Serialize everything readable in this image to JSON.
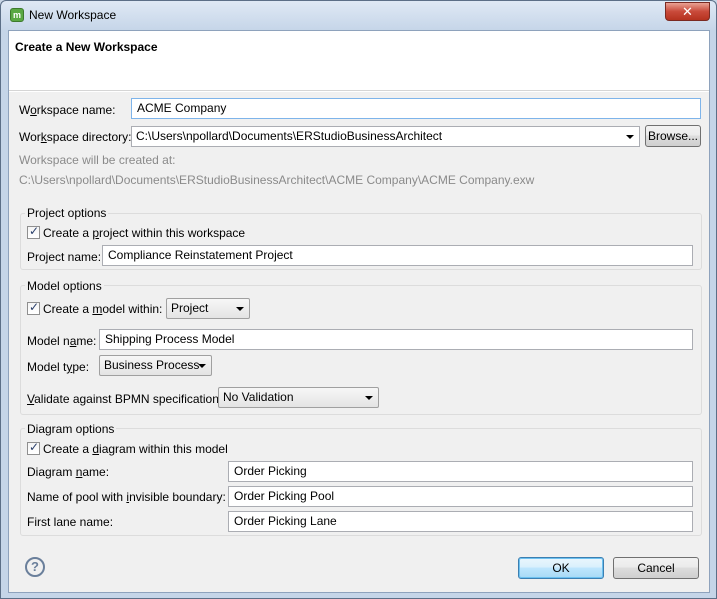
{
  "window": {
    "title": "New Workspace",
    "close_glyph": "✕"
  },
  "banner": {
    "title": "Create a New Workspace"
  },
  "workspace": {
    "name_label_pre": "W",
    "name_label_ul": "o",
    "name_label_post": "rkspace name:",
    "name_value": "ACME Company",
    "dir_label_pre": "Wor",
    "dir_label_ul": "k",
    "dir_label_post": "space directory:",
    "dir_value": "C:\\Users\\npollard\\Documents\\ERStudioBusinessArchitect",
    "browse_label": "Browse...",
    "created_at_label": "Workspace will be created at:",
    "created_at_path": "C:\\Users\\npollard\\Documents\\ERStudioBusinessArchitect\\ACME Company\\ACME Company.exw"
  },
  "project_options": {
    "title": "Project options",
    "checkbox_pre": "Create a ",
    "checkbox_ul": "p",
    "checkbox_post": "roject within this workspace",
    "checked": true,
    "name_label": "Project name:",
    "name_value": "Compliance Reinstatement Project"
  },
  "model_options": {
    "title": "Model options",
    "checkbox_pre": "Create a ",
    "checkbox_ul": "m",
    "checkbox_post": "odel within:",
    "checked": true,
    "within_value": "Project",
    "name_label_pre": "Model n",
    "name_label_ul": "a",
    "name_label_post": "me:",
    "name_value": "Shipping Process Model",
    "type_label_pre": "Model t",
    "type_label_ul": "y",
    "type_label_post": "pe:",
    "type_value": "Business Process",
    "validate_label_pre": "",
    "validate_label_ul": "V",
    "validate_label_post": "alidate against BPMN specification:",
    "validate_value": "No Validation"
  },
  "diagram_options": {
    "title": "Diagram options",
    "checkbox_pre": "Create a ",
    "checkbox_ul": "d",
    "checkbox_post": "iagram within this model",
    "checked": true,
    "name_label_pre": "Diagram ",
    "name_label_ul": "n",
    "name_label_post": "ame:",
    "name_value": "Order Picking",
    "pool_label_pre": "Name of pool with ",
    "pool_label_ul": "i",
    "pool_label_post": "nvisible boundary:",
    "pool_value": "Order Picking Pool",
    "lane_label": "First lane name:",
    "lane_value": "Order Picking Lane"
  },
  "footer": {
    "help_glyph": "?",
    "ok_label": "OK",
    "cancel_label": "Cancel"
  },
  "check_glyph": "✓"
}
